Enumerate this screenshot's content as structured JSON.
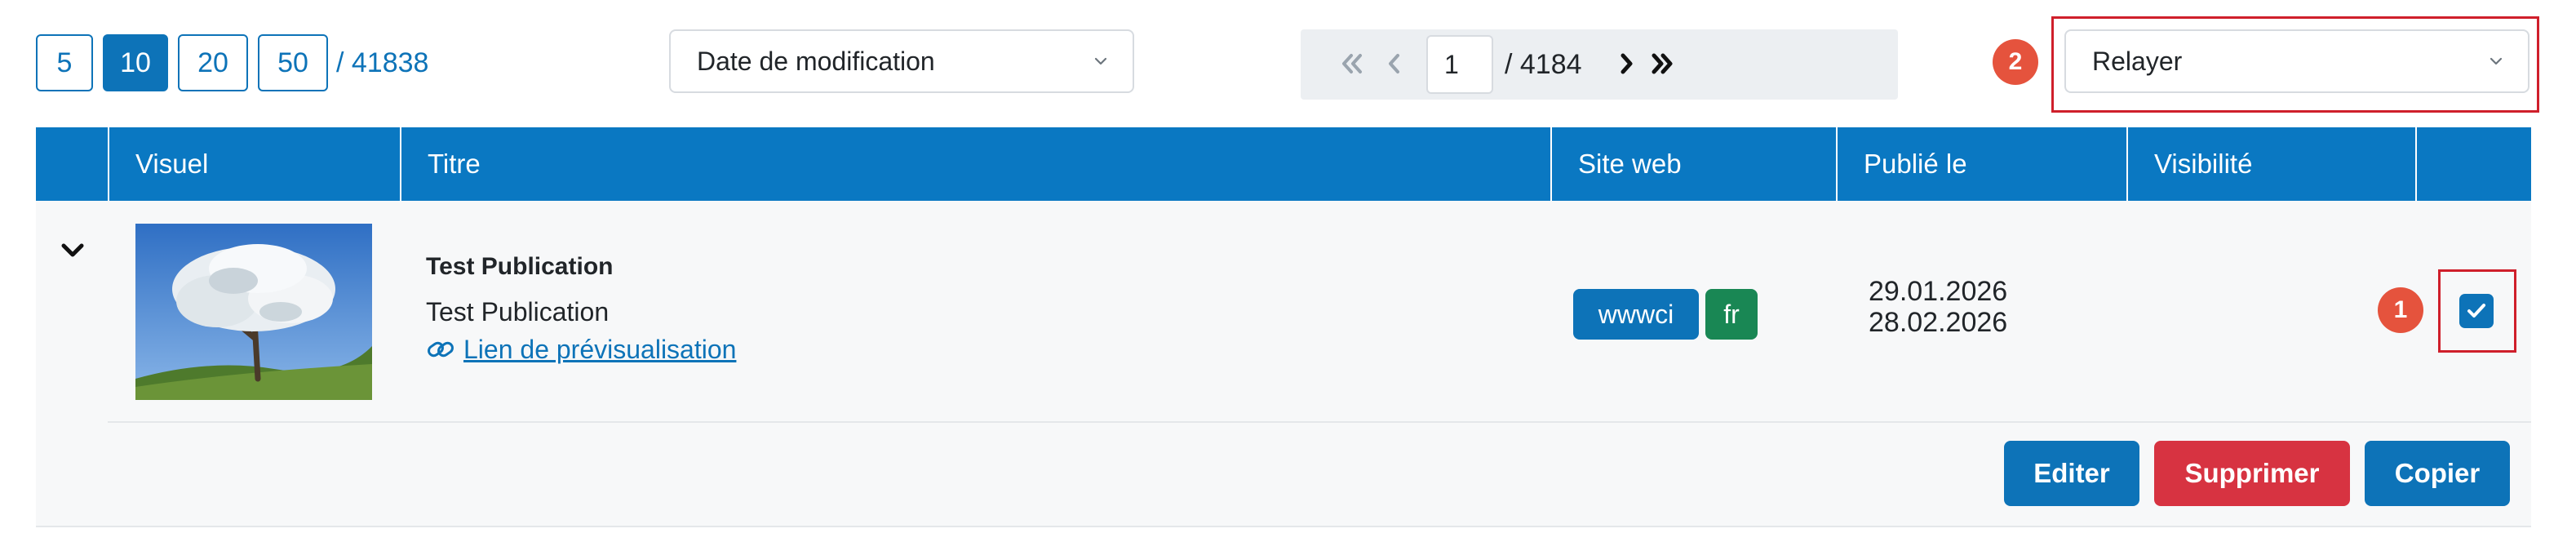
{
  "per_page": {
    "options": [
      "5",
      "10",
      "20",
      "50"
    ],
    "selected": "10",
    "total_label": "/ 41838"
  },
  "sort": {
    "selected": "Date de modification",
    "chevron_icon": "chevron-down-icon"
  },
  "pagination": {
    "current_page": "1",
    "total_pages_label": "/ 4184",
    "icons": [
      "first-page-icon",
      "previous-page-icon",
      "next-page-icon",
      "last-page-icon"
    ]
  },
  "action_select": {
    "selected": "Relayer",
    "chevron_icon": "chevron-down-icon"
  },
  "annotations": {
    "marker_1": "1",
    "marker_2": "2",
    "color": "#e5533d",
    "frame_color": "#cf1f2b"
  },
  "table": {
    "columns": [
      "Visuel",
      "Titre",
      "Site web",
      "Publié le",
      "Visibilité"
    ],
    "header_color": "#0a78c2",
    "rows": [
      {
        "title": "Test Publication",
        "subtitle": "Test Publication",
        "preview_link": "Lien de prévisualisation",
        "image": "blossoming-tree-thumbnail",
        "site_tags": [
          {
            "label": "wwwci",
            "color": "#0d73b8"
          },
          {
            "label": "fr",
            "color": "#198754"
          }
        ],
        "published_from": "29.01.2026",
        "published_to": "28.02.2026",
        "selected": true,
        "actions": [
          {
            "label": "Editer",
            "color": "#0d73b8"
          },
          {
            "label": "Supprimer",
            "color": "#d73341"
          },
          {
            "label": "Copier",
            "color": "#0d73b8"
          }
        ]
      }
    ]
  }
}
